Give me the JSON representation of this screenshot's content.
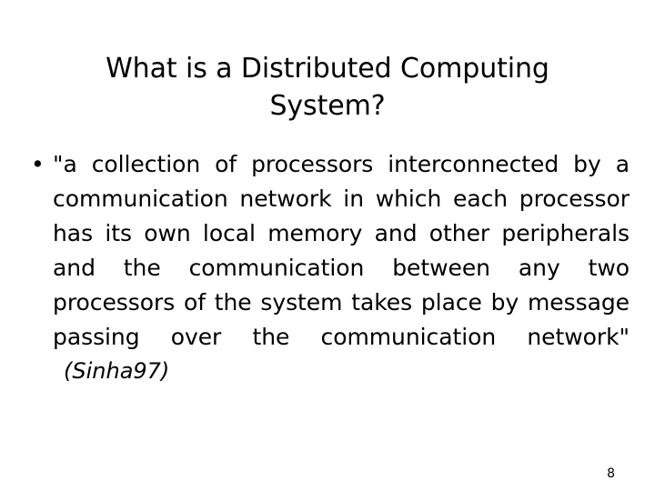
{
  "slide": {
    "background_color": "#ffffff",
    "text_color": "#000000",
    "title": "What is a Distributed Computing System?",
    "body": {
      "bullet_glyph": "•",
      "quote": "\"a collection of processors interconnected by a communication network in which each processor has its own local memory and other peripherals and the communication between any two processors of the system takes place by message passing over the communication network\"",
      "lines": [
        "\"a collection of processors interconnected by a",
        "communication network in which each processor",
        "has its own local memory and other peripherals",
        "and the communication between any two",
        "processors of the system takes place by message",
        "passing over the communication network\""
      ],
      "citation": "(Sinha97)"
    },
    "page_number": "8"
  }
}
